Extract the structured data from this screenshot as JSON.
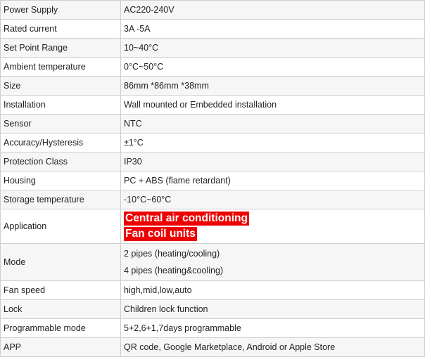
{
  "colors": {
    "highlight_bg": "#ee0000",
    "highlight_text": "#ffffff",
    "border": "#cfcfcf"
  },
  "rows": [
    {
      "label": "Power Supply",
      "value": "AC220-240V"
    },
    {
      "label": "Rated current",
      "value": "3A -5A"
    },
    {
      "label": "Set Point Range",
      "value": "10~40°C"
    },
    {
      "label": "Ambient temperature",
      "value": "0°C~50°C"
    },
    {
      "label": "Size",
      "value": "86mm *86mm *38mm"
    },
    {
      "label": "Installation",
      "value": "Wall mounted or Embedded installation"
    },
    {
      "label": "Sensor",
      "value": "NTC"
    },
    {
      "label": "Accuracy/Hysteresis",
      "value": "±1°C"
    },
    {
      "label": "Protection Class",
      "value": "IP30"
    },
    {
      "label": "Housing",
      "value": "PC + ABS (flame retardant)"
    },
    {
      "label": "Storage temperature",
      "value": "-10°C~60°C"
    },
    {
      "label": "Application",
      "values": [
        "Central air conditioning",
        "Fan coil units"
      ]
    },
    {
      "label": "Mode",
      "values": [
        "2 pipes (heating/cooling)",
        "4 pipes (heating&cooling)"
      ]
    },
    {
      "label": "Fan speed",
      "value": "high,mid,low,auto"
    },
    {
      "label": "Lock",
      "value": "Children lock function"
    },
    {
      "label": "Programmable mode",
      "value": "5+2,6+1,7days programmable"
    },
    {
      "label": "APP",
      "value": "QR code, Google Marketplace, Android or Apple Store"
    }
  ]
}
